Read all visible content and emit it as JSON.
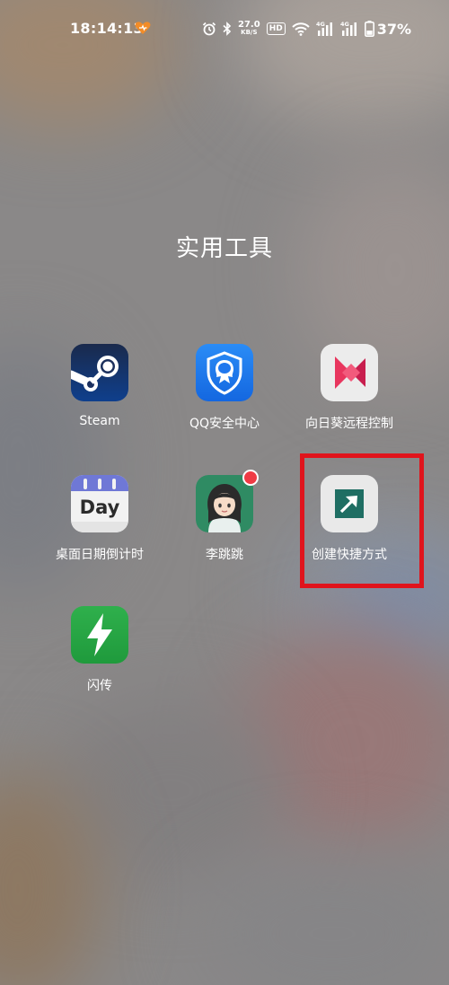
{
  "status_bar": {
    "time": "18:14:13",
    "net_speed_value": "27.0",
    "net_speed_unit": "KB/S",
    "hd_label": "HD",
    "signal1_label": "4G",
    "signal2_label": "4G",
    "battery_percent": "37%",
    "battery_level": 0.37
  },
  "folder": {
    "title": "实用工具"
  },
  "apps": [
    {
      "label": "Steam",
      "icon": "steam-icon"
    },
    {
      "label": "QQ安全中心",
      "icon": "qq-security-icon"
    },
    {
      "label": "向日葵远程控制",
      "icon": "sunflower-remote-icon"
    },
    {
      "label": "桌面日期倒计时",
      "icon": "day-countdown-icon",
      "icon_text": "Day"
    },
    {
      "label": "李跳跳",
      "icon": "li-tiaotiao-icon"
    },
    {
      "label": "创建快捷方式",
      "icon": "shortcut-creator-icon"
    },
    {
      "label": "闪传",
      "icon": "flash-transfer-icon"
    }
  ],
  "colors": {
    "highlight_frame": "#e0141c",
    "notification_dot": "#ef3b45",
    "heart_accent": "#f28c28"
  }
}
